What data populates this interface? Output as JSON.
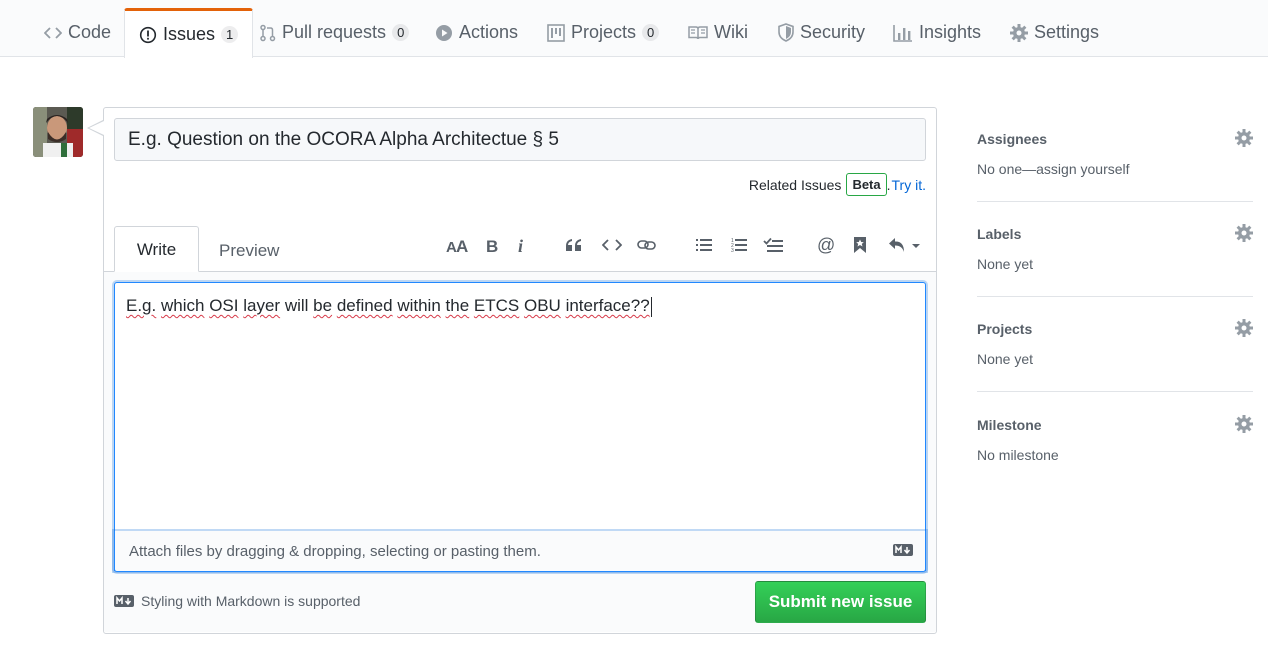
{
  "nav": {
    "tabs": [
      {
        "label": "Code",
        "icon": "code-icon"
      },
      {
        "label": "Issues",
        "icon": "issue-opened-icon",
        "count": "1",
        "selected": true
      },
      {
        "label": "Pull requests",
        "icon": "git-pull-request-icon",
        "count": "0"
      },
      {
        "label": "Actions",
        "icon": "play-icon"
      },
      {
        "label": "Projects",
        "icon": "project-icon",
        "count": "0"
      },
      {
        "label": "Wiki",
        "icon": "book-icon"
      },
      {
        "label": "Security",
        "icon": "shield-icon"
      },
      {
        "label": "Insights",
        "icon": "graph-icon"
      },
      {
        "label": "Settings",
        "icon": "gear-icon"
      }
    ],
    "accent_color": "#e36209"
  },
  "issue_form": {
    "title_placeholder": "E.g. Question on the OCORA Alpha Architectue § 5",
    "related_issues_label": "Related Issues",
    "beta_badge": "Beta",
    "period": ".",
    "try_it": "Try it.",
    "write_tab": "Write",
    "preview_tab": "Preview",
    "body_words": [
      "E.g.",
      "which",
      "OSI",
      "layer",
      "will",
      "be",
      "defined",
      "within",
      "the",
      "ETCS",
      "OBU",
      "interface??"
    ],
    "attach_hint": "Attach files by dragging & dropping, selecting or pasting them.",
    "markdown_support": "Styling with Markdown is supported",
    "submit_label": "Submit new issue",
    "submit_color": "#28a745"
  },
  "sidebar": {
    "assignees": {
      "title": "Assignees",
      "value": "No one—assign yourself"
    },
    "labels": {
      "title": "Labels",
      "value": "None yet"
    },
    "projects": {
      "title": "Projects",
      "value": "None yet"
    },
    "milestone": {
      "title": "Milestone",
      "value": "No milestone"
    }
  }
}
